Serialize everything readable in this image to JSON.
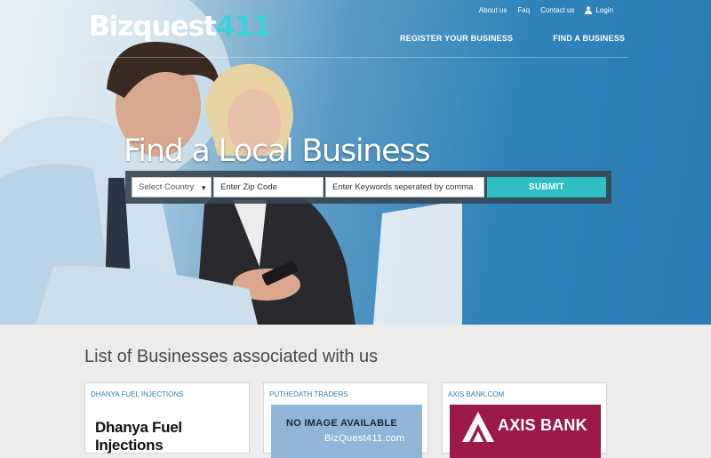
{
  "header": {
    "logo_main": "izquest",
    "logo_mark": "B",
    "logo_num": "411",
    "top_links": {
      "about": "About us",
      "faq": "Faq",
      "contact": "Contact us",
      "login": "Login"
    },
    "nav": {
      "register": "REGISTER YOUR BUSINESS",
      "find": "FIND A BUSINESS"
    }
  },
  "hero": {
    "headline": "Find a Local Business"
  },
  "search": {
    "country_placeholder": "Select Country",
    "zip_placeholder": "Enter Zip Code",
    "keywords_placeholder": "Enter Keywords seperated by comma",
    "submit_label": "SUBMIT"
  },
  "listing": {
    "title": "List of Businesses associated with us",
    "cards": [
      {
        "name": "DHANYA FUEL INJECTIONS",
        "logo_text": "Dhanya Fuel Injections"
      },
      {
        "name": "PUTHEDATH TRADERS",
        "image_line1": "NO IMAGE AVAILABLE",
        "image_line2": "BizQuest411.com"
      },
      {
        "name": "AXIS BANK.COM",
        "logo_text": "AXIS BANK"
      }
    ]
  },
  "icons": {
    "login": "user-icon",
    "dropdown": "caret-down-icon"
  },
  "colors": {
    "accent": "#2fbec2",
    "hero_blue": "#2f83b9",
    "link": "#2e7fb4",
    "axis": "#9c1a4a"
  }
}
